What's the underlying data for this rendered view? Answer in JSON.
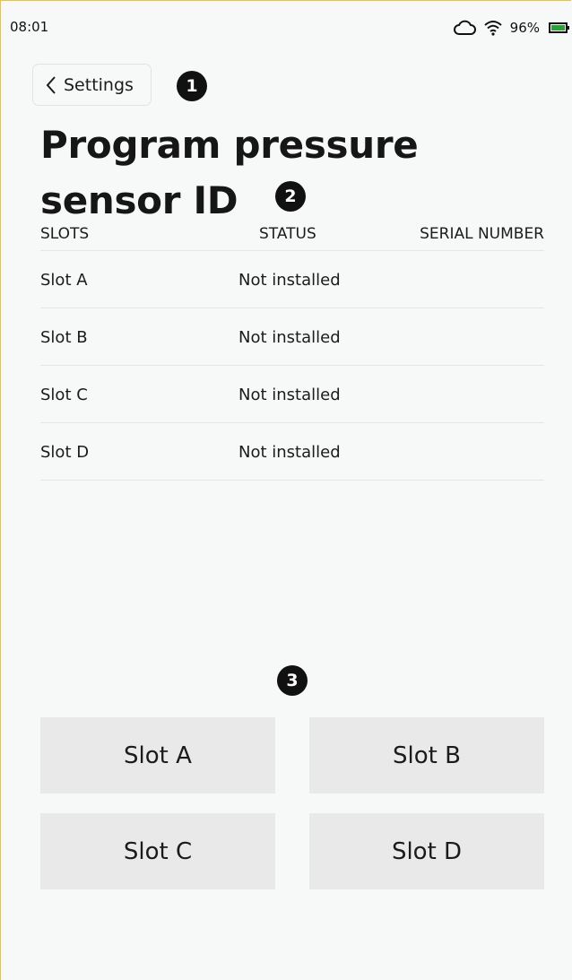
{
  "status_bar": {
    "time": "08:01",
    "battery": "96%",
    "icons": [
      "cloud-icon",
      "wifi-icon",
      "battery-icon"
    ],
    "battery_color": "#2e9e3a"
  },
  "header": {
    "back_label": "Settings",
    "title": "Program pressure sensor ID"
  },
  "annotations": [
    "1",
    "2",
    "3"
  ],
  "table": {
    "columns": [
      "SLOTS",
      "STATUS",
      "SERIAL NUMBER"
    ],
    "rows": [
      {
        "slot": "Slot A",
        "status": "Not installed",
        "serial": ""
      },
      {
        "slot": "Slot B",
        "status": "Not installed",
        "serial": ""
      },
      {
        "slot": "Slot C",
        "status": "Not installed",
        "serial": ""
      },
      {
        "slot": "Slot D",
        "status": "Not installed",
        "serial": ""
      }
    ]
  },
  "slot_buttons": [
    "Slot A",
    "Slot B",
    "Slot C",
    "Slot D"
  ],
  "colors": {
    "background": "#f7f9f9",
    "button_bg": "#e9e9e9",
    "badge_bg": "#111111",
    "frame_accent": "#f2c230"
  }
}
